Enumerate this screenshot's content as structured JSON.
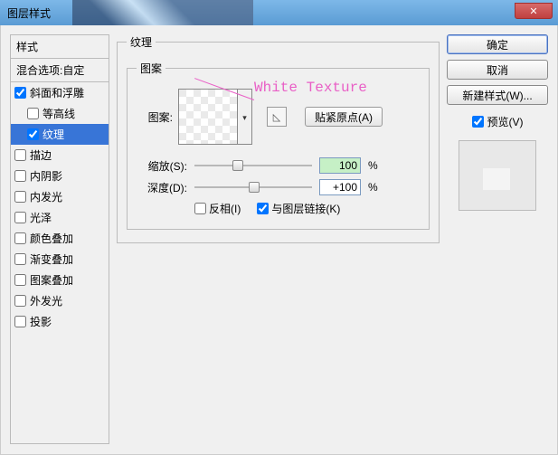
{
  "window": {
    "title": "图层样式"
  },
  "left": {
    "styles_header": "样式",
    "blend_options": "混合选项:自定",
    "items": [
      {
        "label": "斜面和浮雕",
        "checked": true,
        "indent": false
      },
      {
        "label": "等高线",
        "checked": false,
        "indent": true
      },
      {
        "label": "纹理",
        "checked": true,
        "indent": true,
        "selected": true
      },
      {
        "label": "描边",
        "checked": false,
        "indent": false
      },
      {
        "label": "内阴影",
        "checked": false,
        "indent": false
      },
      {
        "label": "内发光",
        "checked": false,
        "indent": false
      },
      {
        "label": "光泽",
        "checked": false,
        "indent": false
      },
      {
        "label": "颜色叠加",
        "checked": false,
        "indent": false
      },
      {
        "label": "渐变叠加",
        "checked": false,
        "indent": false
      },
      {
        "label": "图案叠加",
        "checked": false,
        "indent": false
      },
      {
        "label": "外发光",
        "checked": false,
        "indent": false
      },
      {
        "label": "投影",
        "checked": false,
        "indent": false
      }
    ]
  },
  "mid": {
    "group_title": "纹理",
    "pattern_group": "图案",
    "pattern_label": "图案:",
    "snap_origin": "贴紧原点(A)",
    "annotation": "White Texture",
    "scale_label": "缩放(S):",
    "scale_value": "100",
    "depth_label": "深度(D):",
    "depth_value": "+100",
    "percent": "%",
    "invert_label": "反相(I)",
    "invert_checked": false,
    "link_label": "与图层链接(K)",
    "link_checked": true
  },
  "right": {
    "ok": "确定",
    "cancel": "取消",
    "new_style": "新建样式(W)...",
    "preview_label": "预览(V)",
    "preview_checked": true
  }
}
